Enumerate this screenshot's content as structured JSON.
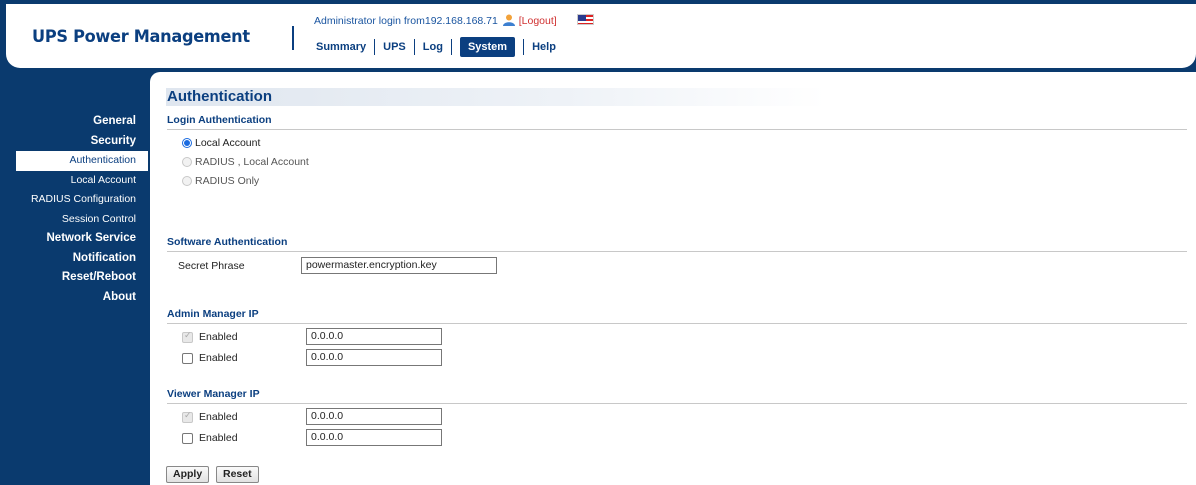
{
  "header": {
    "title": "UPS Power Management",
    "login_prefix": "Administrator login from",
    "login_ip": "192.168.168.71",
    "logout": "[Logout]",
    "flag_icon": "us-flag-icon",
    "nav": [
      {
        "label": "Summary",
        "active": false
      },
      {
        "label": "UPS",
        "active": false
      },
      {
        "label": "Log",
        "active": false
      },
      {
        "label": "System",
        "active": true
      },
      {
        "label": "Help",
        "active": false
      }
    ]
  },
  "sidebar": {
    "items": [
      {
        "label": "General"
      },
      {
        "label": "Security"
      },
      {
        "label": "Authentication"
      },
      {
        "label": "Local Account"
      },
      {
        "label": "RADIUS Configuration"
      },
      {
        "label": "Session Control"
      },
      {
        "label": "Network Service"
      },
      {
        "label": "Notification"
      },
      {
        "label": "Reset/Reboot"
      },
      {
        "label": "About"
      }
    ]
  },
  "page": {
    "title": "Authentication",
    "login_auth": {
      "heading": "Login Authentication",
      "options": [
        {
          "label": "Local Account",
          "selected": true
        },
        {
          "label": "RADIUS , Local Account",
          "selected": false
        },
        {
          "label": "RADIUS Only",
          "selected": false
        }
      ]
    },
    "software_auth": {
      "heading": "Software Authentication",
      "secret_label": "Secret Phrase",
      "secret_value": "powermaster.encryption.key"
    },
    "admin_ip": {
      "heading": "Admin Manager IP",
      "rows": [
        {
          "label": "Enabled",
          "value": "0.0.0.0"
        },
        {
          "label": "Enabled",
          "value": "0.0.0.0"
        }
      ]
    },
    "viewer_ip": {
      "heading": "Viewer Manager IP",
      "rows": [
        {
          "label": "Enabled",
          "value": "0.0.0.0"
        },
        {
          "label": "Enabled",
          "value": "0.0.0.0"
        }
      ]
    },
    "apply_label": "Apply",
    "reset_label": "Reset"
  },
  "colors": {
    "brand": "#0b3f80",
    "background": "#0a3a6e",
    "logout": "#d03030",
    "link": "#1a55a0"
  }
}
